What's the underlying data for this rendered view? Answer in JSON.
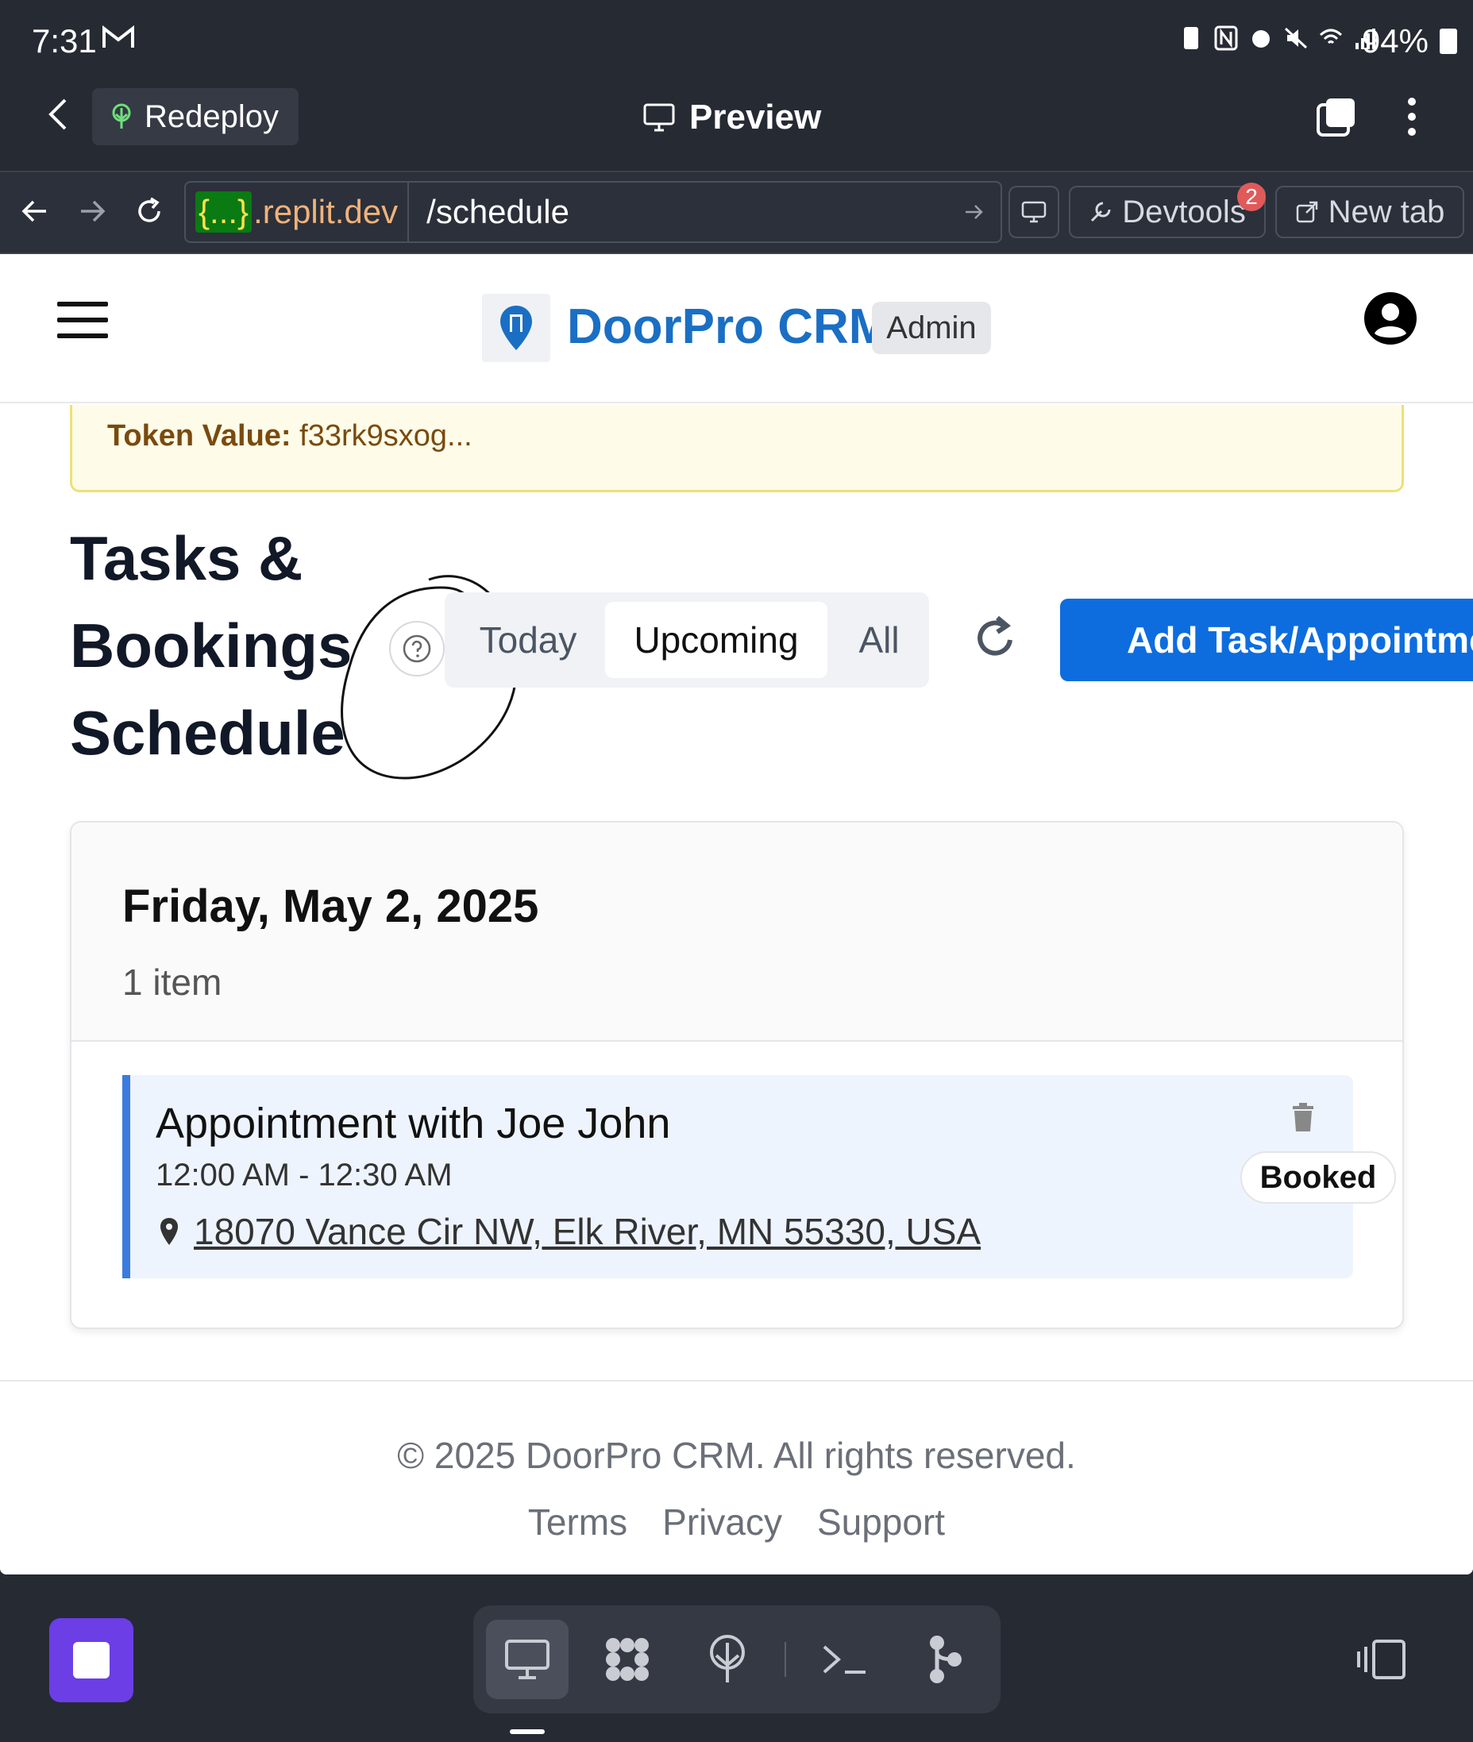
{
  "status_bar": {
    "time": "7:31",
    "battery": "94%"
  },
  "replit_bar": {
    "redeploy_label": "Redeploy",
    "preview_title": "Preview"
  },
  "address_bar": {
    "host_badge": "{...}",
    "host": ".replit.dev",
    "path": "/schedule",
    "devtools_label": "Devtools",
    "devtools_count": "2",
    "new_tab_label": "New tab"
  },
  "site": {
    "brand": "DoorPro CRM",
    "role_badge": "Admin",
    "token": {
      "label": "Token Value:",
      "value": " f33rk9sxog..."
    },
    "page_title": "Tasks & Bookings Schedule",
    "filters": [
      {
        "label": "Today",
        "active": false
      },
      {
        "label": "Upcoming",
        "active": true
      },
      {
        "label": "All",
        "active": false
      }
    ],
    "add_button_label": "Add Task/Appointment",
    "day_group": {
      "date": "Friday, May 2, 2025",
      "count": "1 item",
      "items": [
        {
          "title": "Appointment with Joe John",
          "time": "12:00 AM - 12:30 AM",
          "address": "18070 Vance Cir NW, Elk River, MN 55330, USA",
          "status": "Booked"
        }
      ]
    },
    "footer": {
      "copyright": "© 2025 DoorPro CRM. All rights reserved.",
      "links": [
        "Terms",
        "Privacy",
        "Support"
      ]
    }
  },
  "colors": {
    "brand": "#1a6fc4",
    "primary_button": "#0d6ddf",
    "accent_border": "#3a7be0",
    "stop_button": "#6b3ee6"
  },
  "toolbar_tools": [
    "preview-icon",
    "workspace-icon",
    "deploy-icon",
    "shell-icon",
    "git-icon"
  ]
}
